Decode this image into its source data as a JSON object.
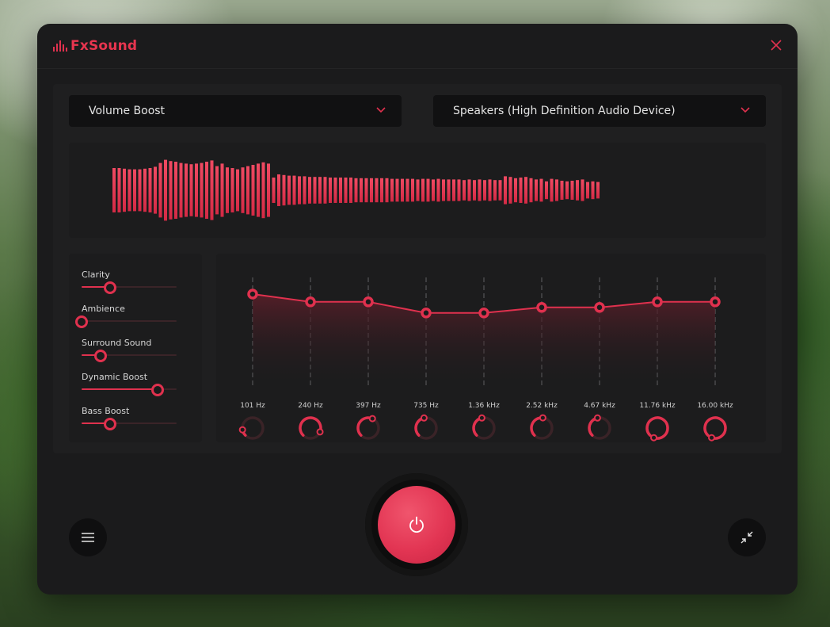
{
  "app": {
    "logo_text": "FxSound",
    "brand_color": "#e0314e"
  },
  "titlebar": {
    "close_icon": "close-icon"
  },
  "presets": {
    "selected": "Volume Boost"
  },
  "output_device": {
    "selected": "Speakers (High Definition Audio Device)"
  },
  "effects": [
    {
      "label": "Clarity",
      "value": 0.3
    },
    {
      "label": "Ambience",
      "value": 0.0
    },
    {
      "label": "Surround Sound",
      "value": 0.2
    },
    {
      "label": "Dynamic Boost",
      "value": 0.8
    },
    {
      "label": "Bass Boost",
      "value": 0.3
    }
  ],
  "equalizer": {
    "bands": [
      {
        "freq": "101 Hz",
        "gain": 0.85
      },
      {
        "freq": "240 Hz",
        "gain": 0.78
      },
      {
        "freq": "397 Hz",
        "gain": 0.78
      },
      {
        "freq": "735 Hz",
        "gain": 0.68
      },
      {
        "freq": "1.36 kHz",
        "gain": 0.68
      },
      {
        "freq": "2.52 kHz",
        "gain": 0.73
      },
      {
        "freq": "4.67 kHz",
        "gain": 0.73
      },
      {
        "freq": "11.76 kHz",
        "gain": 0.78
      },
      {
        "freq": "16.00 kHz",
        "gain": 0.78
      }
    ],
    "knob_levels": [
      0.1,
      0.7,
      0.45,
      0.35,
      0.35,
      0.4,
      0.35,
      0.95,
      0.95
    ]
  },
  "visualizer": {
    "levels": [
      0.7,
      0.7,
      0.68,
      0.66,
      0.66,
      0.66,
      0.68,
      0.7,
      0.74,
      0.86,
      0.96,
      0.92,
      0.9,
      0.86,
      0.84,
      0.82,
      0.84,
      0.86,
      0.9,
      0.94,
      0.76,
      0.84,
      0.72,
      0.7,
      0.66,
      0.72,
      0.76,
      0.8,
      0.84,
      0.88,
      0.84,
      0.4,
      0.5,
      0.48,
      0.46,
      0.46,
      0.44,
      0.44,
      0.42,
      0.42,
      0.42,
      0.42,
      0.4,
      0.4,
      0.4,
      0.4,
      0.4,
      0.38,
      0.38,
      0.38,
      0.38,
      0.38,
      0.38,
      0.38,
      0.36,
      0.36,
      0.36,
      0.36,
      0.36,
      0.34,
      0.36,
      0.36,
      0.34,
      0.36,
      0.34,
      0.34,
      0.34,
      0.34,
      0.32,
      0.34,
      0.32,
      0.34,
      0.32,
      0.34,
      0.32,
      0.32,
      0.44,
      0.42,
      0.38,
      0.4,
      0.42,
      0.38,
      0.34,
      0.36,
      0.28,
      0.36,
      0.34,
      0.3,
      0.28,
      0.3,
      0.32,
      0.34,
      0.26,
      0.28,
      0.26
    ]
  },
  "controls": {
    "menu_icon": "hamburger-menu-icon",
    "power_icon": "power-icon",
    "minimize_icon": "collapse-arrows-icon"
  }
}
